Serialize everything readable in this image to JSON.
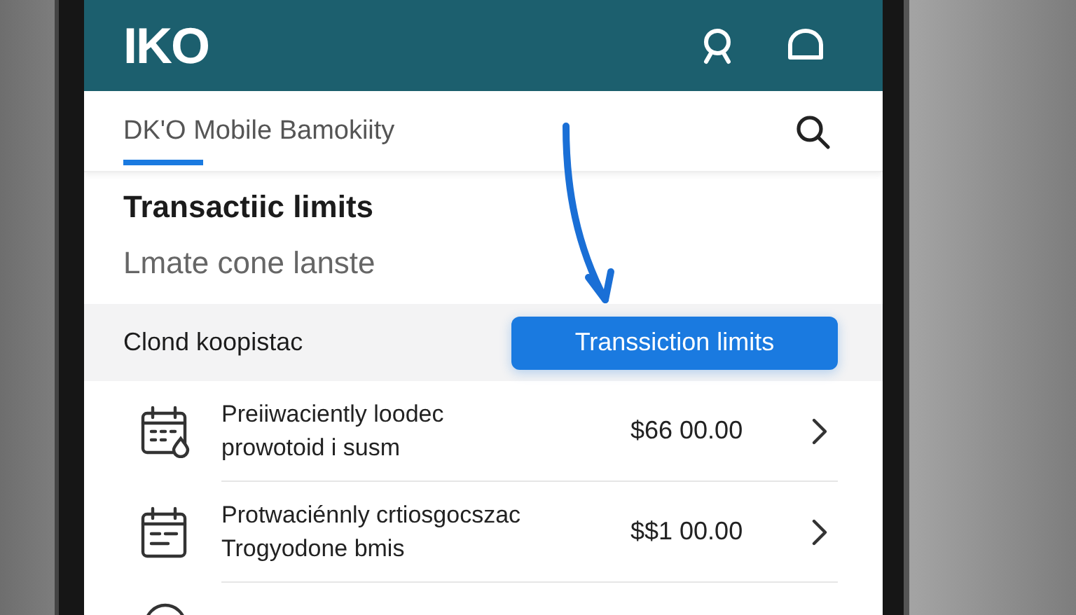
{
  "header": {
    "logo": "IKO"
  },
  "tabs": [
    {
      "label": "DK'O Mobile Bamokiity",
      "selected": true
    }
  ],
  "section": {
    "title": "Transactiic limits",
    "subtitle": "Lmate cone lanste"
  },
  "filter_row": {
    "label": "Clond koopistac",
    "button": "Transsiction limits"
  },
  "rows": [
    {
      "kind": "calendar-drop",
      "lines": [
        "Preiiwaciently loodec",
        "prowotoid i susm"
      ],
      "amount": "$66 00.00"
    },
    {
      "kind": "calendar-lines",
      "lines": [
        "Protwaciénnly crtiosgocszac",
        "Trogyodone bmis"
      ],
      "amount": "$$1 00.00"
    }
  ]
}
